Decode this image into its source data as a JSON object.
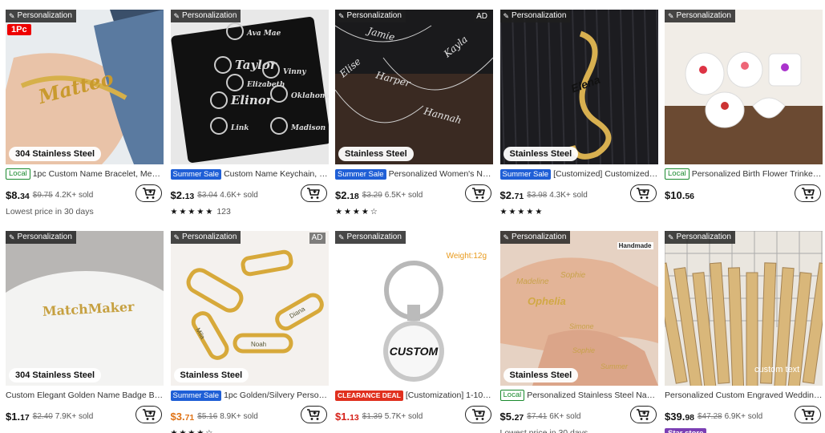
{
  "products": [
    {
      "tag": "Personalization",
      "ad": "",
      "onepc": "1Pc",
      "steel": "304 Stainless Steel",
      "badge_type": "local",
      "badge": "Local",
      "title": "1pc Custom Name Bracelet, Men's ...",
      "price_int": "$8.",
      "price_cents": "34",
      "price_color": "dark",
      "orig": "$9.75",
      "sold": "4.2K+ sold",
      "extra_type": "text",
      "extra": "Lowest price in 30 days",
      "rating": ""
    },
    {
      "tag": "Personalization",
      "ad": "",
      "onepc": "",
      "steel": "",
      "badge_type": "summer",
      "badge": "Summer Sale",
      "title": "Custom Name Keychain, Person...",
      "price_int": "$2.",
      "price_cents": "13",
      "price_color": "dark",
      "orig": "$3.04",
      "sold": "4.6K+ sold",
      "extra_type": "stars",
      "extra": "★★★★★",
      "rating": "123"
    },
    {
      "tag": "Personalization",
      "ad": "AD",
      "onepc": "",
      "steel": "Stainless Steel",
      "badge_type": "summer",
      "badge": "Summer Sale",
      "title": "Personalized Women's Name ...",
      "price_int": "$2.",
      "price_cents": "18",
      "price_color": "dark",
      "orig": "$3.29",
      "sold": "6.5K+ sold",
      "extra_type": "stars",
      "extra": "★★★★☆",
      "rating": ""
    },
    {
      "tag": "Personalization",
      "ad": "",
      "onepc": "",
      "steel": "Stainless Steel",
      "badge_type": "summer",
      "badge": "Summer Sale",
      "title": "[Customized] Customized Na...",
      "price_int": "$2.",
      "price_cents": "71",
      "price_color": "dark",
      "orig": "$3.98",
      "sold": "4.3K+ sold",
      "extra_type": "stars",
      "extra": "★★★★★",
      "rating": ""
    },
    {
      "tag": "Personalization",
      "ad": "",
      "onepc": "",
      "steel": "",
      "badge_type": "local",
      "badge": "Local",
      "title": "Personalized Birth Flower Trinket Di...",
      "price_int": "$10.",
      "price_cents": "56",
      "price_color": "dark",
      "orig": "",
      "sold": "",
      "extra_type": "none",
      "extra": "",
      "rating": ""
    },
    {
      "tag": "Personalization",
      "ad": "",
      "onepc": "",
      "steel": "304 Stainless Steel",
      "badge_type": "none",
      "badge": "",
      "title": "Custom Elegant Golden Name Badge Broo...",
      "price_int": "$1.",
      "price_cents": "17",
      "price_color": "dark",
      "orig": "$2.40",
      "sold": "7.9K+ sold",
      "extra_type": "none",
      "extra": "",
      "rating": ""
    },
    {
      "tag": "Personalization",
      "ad": "AD",
      "onepc": "",
      "steel": "Stainless Steel",
      "badge_type": "summer",
      "badge": "Summer Sale",
      "title": "1pc Golden/Silvery Personaliz...",
      "price_int": "$3.",
      "price_cents": "71",
      "price_color": "orange",
      "orig": "$5.16",
      "sold": "8.9K+ sold",
      "extra_type": "stars",
      "extra": "★★★★☆",
      "rating": ""
    },
    {
      "tag": "Personalization",
      "ad": "",
      "onepc": "",
      "steel": "",
      "weight": "Weight:12g",
      "badge_type": "clear",
      "badge": "CLEARANCE DEAL",
      "title": "[Customization] 1-10pcs ...",
      "price_int": "$1.",
      "price_cents": "13",
      "price_color": "red",
      "orig": "$1.39",
      "sold": "5.7K+ sold",
      "extra_type": "none",
      "extra": "",
      "rating": ""
    },
    {
      "tag": "Personalization",
      "ad": "",
      "onepc": "",
      "steel": "Stainless Steel",
      "handmade": "Handmade",
      "badge_type": "local",
      "badge": "Local",
      "title": "Personalized Stainless Steel Name ...",
      "price_int": "$5.",
      "price_cents": "27",
      "price_color": "dark",
      "orig": "$7.41",
      "sold": "6K+ sold",
      "extra_type": "text",
      "extra": "Lowest price in 30 days",
      "rating": ""
    },
    {
      "tag": "Personalization",
      "ad": "",
      "onepc": "",
      "steel": "",
      "badge_type": "none",
      "badge": "",
      "title": "Personalized Custom Engraved Wedding E...",
      "price_int": "$39.",
      "price_cents": "98",
      "price_color": "dark",
      "orig": "$47.28",
      "sold": "6.9K+ sold",
      "extra_type": "store",
      "extra": "Star store",
      "rating": ""
    }
  ],
  "image_text": {
    "p1": "Matteo",
    "p2": [
      "Ava Mae",
      "Taylor",
      "Elizabeth",
      "Elinor",
      "Link",
      "Vinny",
      "Oklahoma",
      "Madison"
    ],
    "p3": [
      "Jamie",
      "Elise",
      "Harper",
      "Kayla",
      "Hannah"
    ],
    "p4": "Elena",
    "p6": "MatchMaker",
    "p7": [
      "Noah",
      "Mila",
      "Diana"
    ],
    "p8": "CUSTOM",
    "p9": [
      "Madeline",
      "Sophie",
      "Ophelia",
      "Simone",
      "Sophie",
      "Summer"
    ],
    "p10": "custom text"
  },
  "colors": {
    "summer": "#1f5fd6",
    "local": "#1a8a2e",
    "clearance": "#e0301e",
    "price_orange": "#e07316",
    "star_store": "#7b3fb4"
  }
}
